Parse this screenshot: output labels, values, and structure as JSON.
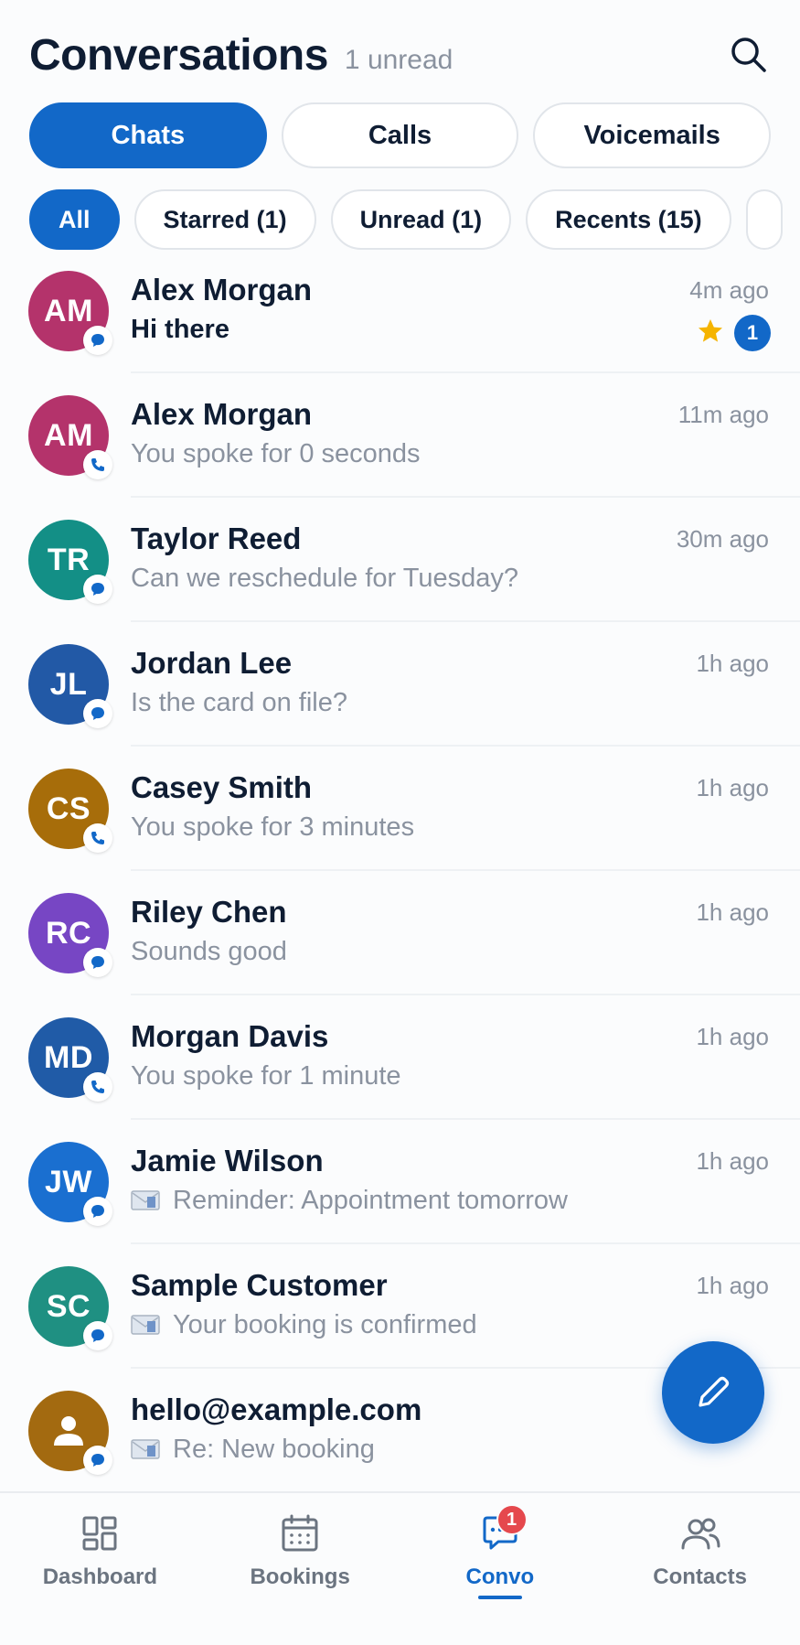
{
  "header": {
    "title": "Conversations",
    "unread_label": "1 unread"
  },
  "tabs": [
    {
      "label": "Chats",
      "active": true
    },
    {
      "label": "Calls",
      "active": false
    },
    {
      "label": "Voicemails",
      "active": false
    }
  ],
  "filters": [
    {
      "label": "All",
      "active": true
    },
    {
      "label": "Starred (1)",
      "active": false
    },
    {
      "label": "Unread (1)",
      "active": false
    },
    {
      "label": "Recents (15)",
      "active": false
    }
  ],
  "colors": {
    "accent": "#1268c8",
    "avatar_magenta": "#b4336b",
    "avatar_teal": "#138f86",
    "avatar_blue": "#2259a6",
    "avatar_gold": "#a76d0a",
    "avatar_purple": "#7746c4",
    "avatar_navy": "#205ba7",
    "avatar_brightblue": "#1a6fd0",
    "avatar_green": "#1f9082",
    "avatar_brown": "#a36a10",
    "star": "#f5b400",
    "badge_red": "#e5484d"
  },
  "conversations": [
    {
      "initials": "AM",
      "name": "Alex Morgan",
      "preview": "Hi there",
      "time": "4m ago",
      "type": "chat-bubble-icon",
      "starred": true,
      "unread_count": "1",
      "avatar_color": "#b4336b",
      "email": false
    },
    {
      "initials": "AM",
      "name": "Alex Morgan",
      "preview": "You spoke for 0 seconds",
      "time": "11m ago",
      "type": "phone-icon",
      "avatar_color": "#b4336b",
      "email": false
    },
    {
      "initials": "TR",
      "name": "Taylor Reed",
      "preview": "Can we reschedule for Tuesday?",
      "time": "30m ago",
      "type": "chat-bubble-icon",
      "avatar_color": "#138f86",
      "email": false
    },
    {
      "initials": "JL",
      "name": "Jordan Lee",
      "preview": "Is the card on file?",
      "time": "1h ago",
      "type": "chat-bubble-icon",
      "avatar_color": "#2259a6",
      "email": false
    },
    {
      "initials": "CS",
      "name": "Casey Smith",
      "preview": "You spoke for 3 minutes",
      "time": "1h ago",
      "type": "phone-icon",
      "avatar_color": "#a76d0a",
      "email": false
    },
    {
      "initials": "RC",
      "name": "Riley Chen",
      "preview": "Sounds good",
      "time": "1h ago",
      "type": "chat-bubble-icon",
      "avatar_color": "#7746c4",
      "email": false
    },
    {
      "initials": "MD",
      "name": "Morgan Davis",
      "preview": "You spoke for 1 minute",
      "time": "1h ago",
      "type": "phone-icon",
      "avatar_color": "#205ba7",
      "email": false
    },
    {
      "initials": "JW",
      "name": "Jamie Wilson",
      "preview": "Reminder: Appointment tomorrow",
      "time": "1h ago",
      "type": "chat-bubble-icon",
      "avatar_color": "#1a6fd0",
      "email": true
    },
    {
      "initials": "SC",
      "name": "Sample Customer",
      "preview": "Your booking is confirmed",
      "time": "1h ago",
      "type": "chat-bubble-icon",
      "avatar_color": "#1f9082",
      "email": true
    },
    {
      "initials": "",
      "name": "hello@example.com",
      "preview": "Re: New booking",
      "time": "",
      "type": "chat-bubble-icon",
      "avatar_color": "#a36a10",
      "email": true,
      "person_icon": true
    }
  ],
  "bottom_nav": [
    {
      "label": "Dashboard",
      "icon": "dashboard-icon",
      "active": false
    },
    {
      "label": "Bookings",
      "icon": "calendar-icon",
      "active": false
    },
    {
      "label": "Convo",
      "icon": "chat-icon",
      "active": true,
      "badge": "1"
    },
    {
      "label": "Contacts",
      "icon": "contacts-icon",
      "active": false
    }
  ],
  "fab_icon": "pencil-icon"
}
